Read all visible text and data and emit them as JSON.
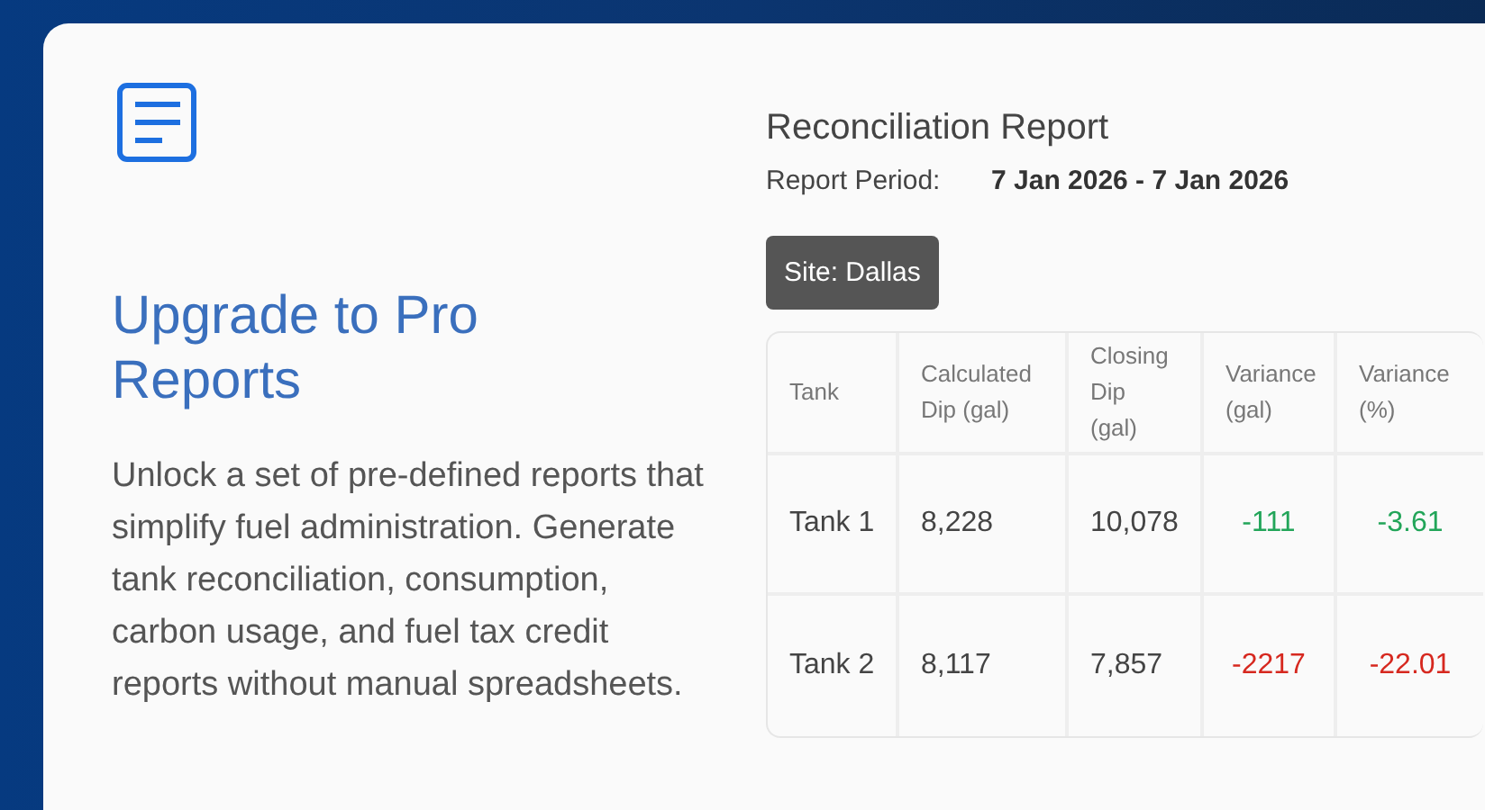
{
  "promo": {
    "title": "Upgrade to Pro Reports",
    "description": "Unlock a set of pre-defined reports that simplify fuel administration. Generate tank reconciliation, consumption, carbon usage, and fuel tax credit reports without manual spreadsheets."
  },
  "report": {
    "title": "Reconciliation Report",
    "period_label": "Report Period:",
    "period_value": "7 Jan 2026 - 7 Jan 2026",
    "site": "Site: Dallas",
    "columns": [
      "Tank",
      "Calculated Dip (gal)",
      "Closing Dip (gal)",
      "Variance (gal)",
      "Variance (%)"
    ],
    "rows": [
      {
        "cells": [
          "Tank 1",
          "8,228",
          "10,078",
          "-111",
          "-3.61"
        ],
        "color": "#22a559"
      },
      {
        "cells": [
          "Tank 2",
          "8,117",
          "7,857",
          "-2217",
          "-22.01"
        ],
        "color": "#d6281f"
      }
    ]
  }
}
